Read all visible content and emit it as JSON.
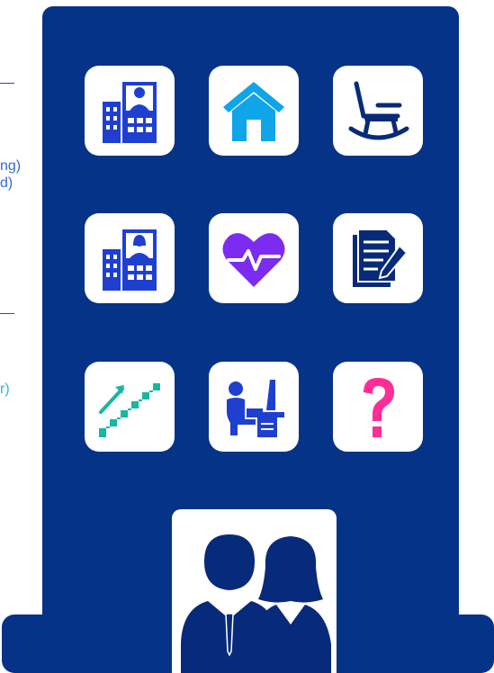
{
  "side_text": {
    "line1": "ng)",
    "line2": "d)",
    "line3": "r)"
  },
  "colors": {
    "tower": "#053388",
    "tile": "#ffffff",
    "office_blue": "#1f3fd1",
    "home_cyan": "#0ea5e9",
    "heart_purple": "#7b2cf0",
    "stairs_green": "#15b8a0",
    "question_pink": "#ff2d95",
    "icon_navy": "#082a7a"
  },
  "icons": [
    "office-building-icon",
    "home-icon",
    "rocking-chair-icon",
    "office-building-woman-icon",
    "heart-rate-icon",
    "document-pen-icon",
    "career-stairs-icon",
    "desk-worker-icon",
    "question-mark-icon",
    "man-woman-icon"
  ]
}
